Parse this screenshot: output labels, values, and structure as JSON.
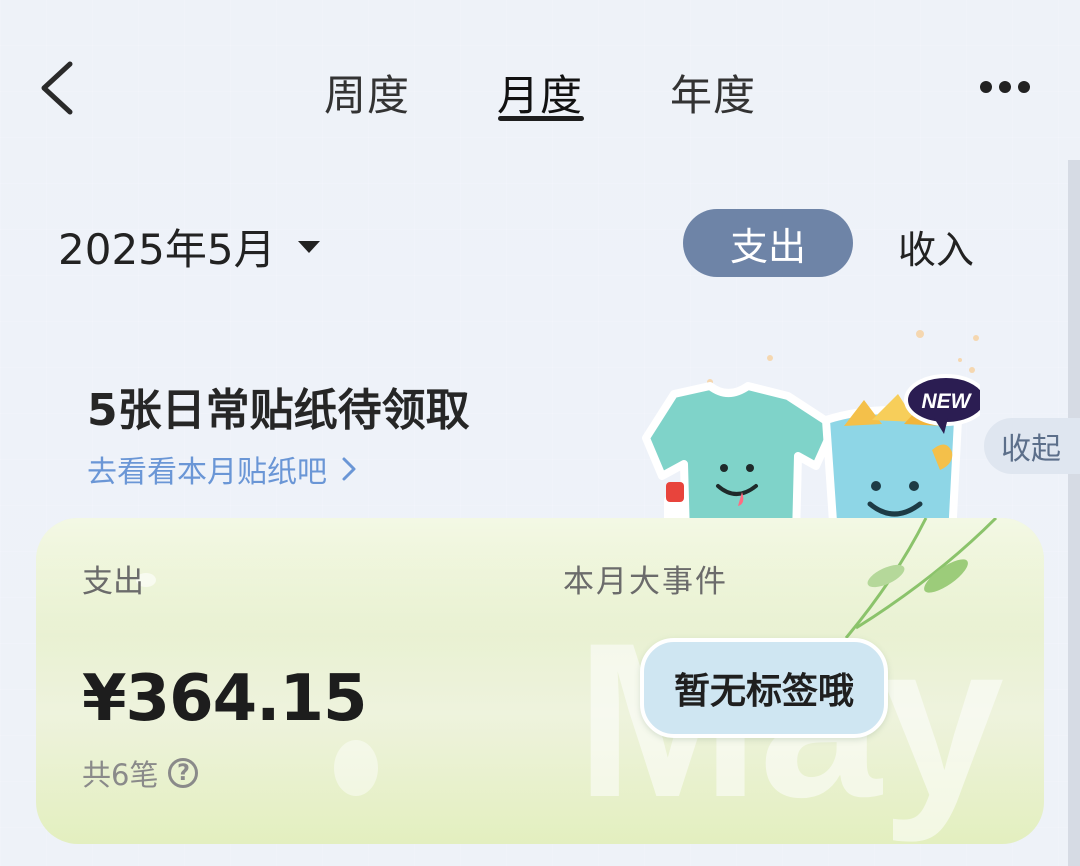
{
  "nav": {
    "back_icon": "chevron-left-icon",
    "tabs": [
      {
        "label": "周度",
        "active": false
      },
      {
        "label": "月度",
        "active": true
      },
      {
        "label": "年度",
        "active": false
      }
    ],
    "more_icon": "more-dots-icon"
  },
  "period": {
    "label": "2025年5月",
    "caret_icon": "caret-down-icon"
  },
  "type_toggle": {
    "expense": "支出",
    "income": "收入",
    "selected": "支出"
  },
  "banner": {
    "title": "5张日常贴纸待领取",
    "link": "去看看本月贴纸吧",
    "link_icon": "chevron-right-icon",
    "collapse": "收起",
    "badge": "NEW"
  },
  "summary": {
    "expense_label": "支出",
    "amount": "¥364.15",
    "count": "共6笔",
    "help_icon": "question-circle-icon",
    "events_label": "本月大事件",
    "no_tag": "暂无标签哦",
    "watermark": "May"
  },
  "colors": {
    "accent": "#6e84a7",
    "link": "#6a96d6",
    "card_green": "#e5f0c4"
  }
}
